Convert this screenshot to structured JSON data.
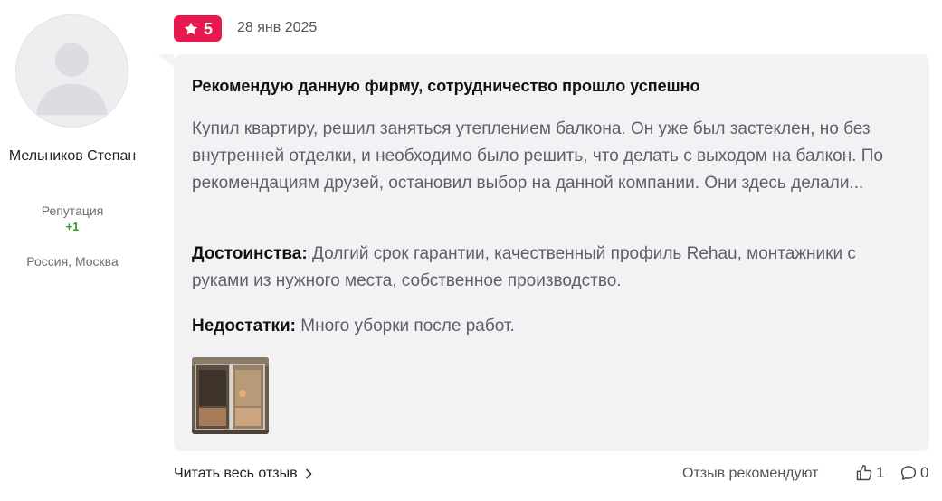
{
  "author": {
    "avatar_icon": "user-placeholder-icon",
    "name": "Мельников Степан",
    "reputation_label": "Репутация",
    "reputation_value": "+1",
    "location": "Россия, Москва"
  },
  "review": {
    "rating": "5",
    "rating_icon": "star-icon",
    "date": "28 янв 2025",
    "title": "Рекомендую данную фирму, сотрудничество прошло успешно",
    "body": "Купил квартиру, решил заняться утеплением балкона. Он уже был застеклен, но без внутренней отделки, и необходимо было решить, что делать с выходом на балкон. По рекомендациям друзей, остановил выбор на данной компании. Они здесь делали...",
    "pros_label": "Достоинства:",
    "pros_text": "Долгий срок гарантии, качественный профиль Rehau, монтажники с руками из нужного места, собственное производство.",
    "cons_label": "Недостатки:",
    "cons_text": "Много уборки после работ.",
    "photo_icon": "balcony-photo-thumbnail"
  },
  "footer": {
    "read_more": "Читать весь отзыв",
    "read_more_icon": "chevron-right-icon",
    "recommend_label": "Отзыв рекомендуют",
    "likes_count": "1",
    "likes_icon": "thumbs-up-icon",
    "comments_count": "0",
    "comments_icon": "comment-icon"
  },
  "colors": {
    "accent": "#e8194f",
    "bubble_bg": "#f2f2f5",
    "reputation_green": "#27a51f"
  }
}
